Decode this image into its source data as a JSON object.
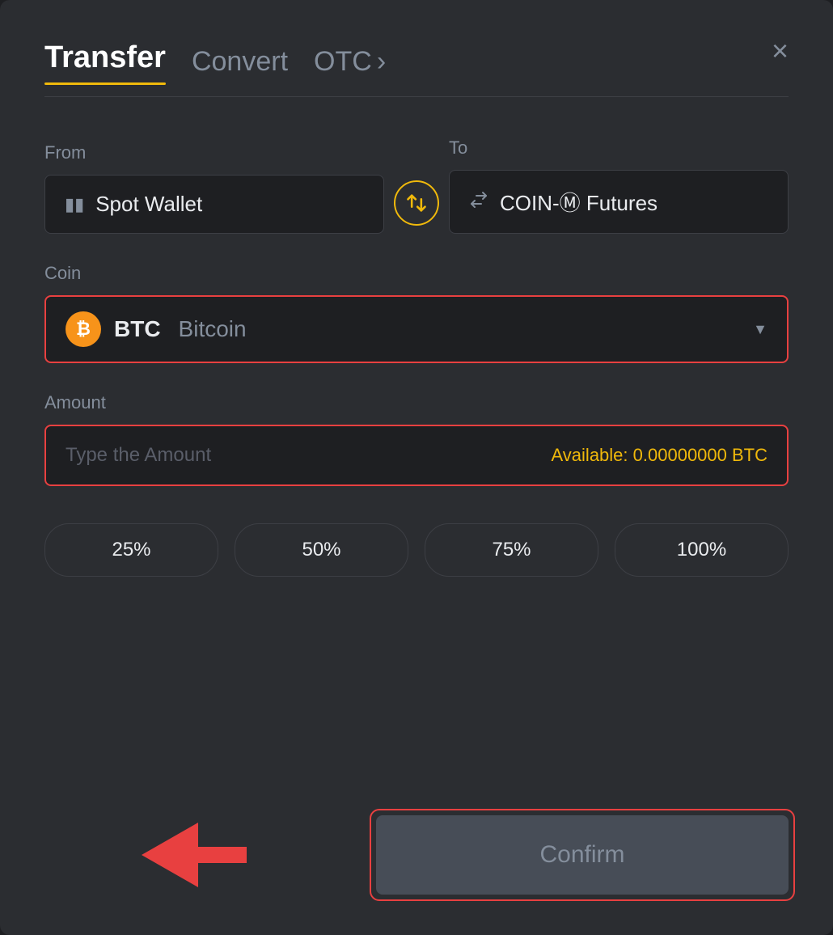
{
  "header": {
    "tab_transfer": "Transfer",
    "tab_convert": "Convert",
    "tab_otc": "OTC",
    "tab_otc_chevron": "›",
    "close_label": "×"
  },
  "from": {
    "label": "From",
    "wallet_name": "Spot Wallet"
  },
  "to": {
    "label": "To",
    "wallet_name": "COIN-Ⓜ Futures"
  },
  "coin": {
    "label": "Coin",
    "symbol": "BTC",
    "full_name": "Bitcoin"
  },
  "amount": {
    "label": "Amount",
    "placeholder": "Type the Amount",
    "available_label": "Available:",
    "available_value": "0.00000000 BTC"
  },
  "percent_buttons": [
    {
      "label": "25%"
    },
    {
      "label": "50%"
    },
    {
      "label": "75%"
    },
    {
      "label": "100%"
    }
  ],
  "confirm_button": {
    "label": "Confirm"
  }
}
